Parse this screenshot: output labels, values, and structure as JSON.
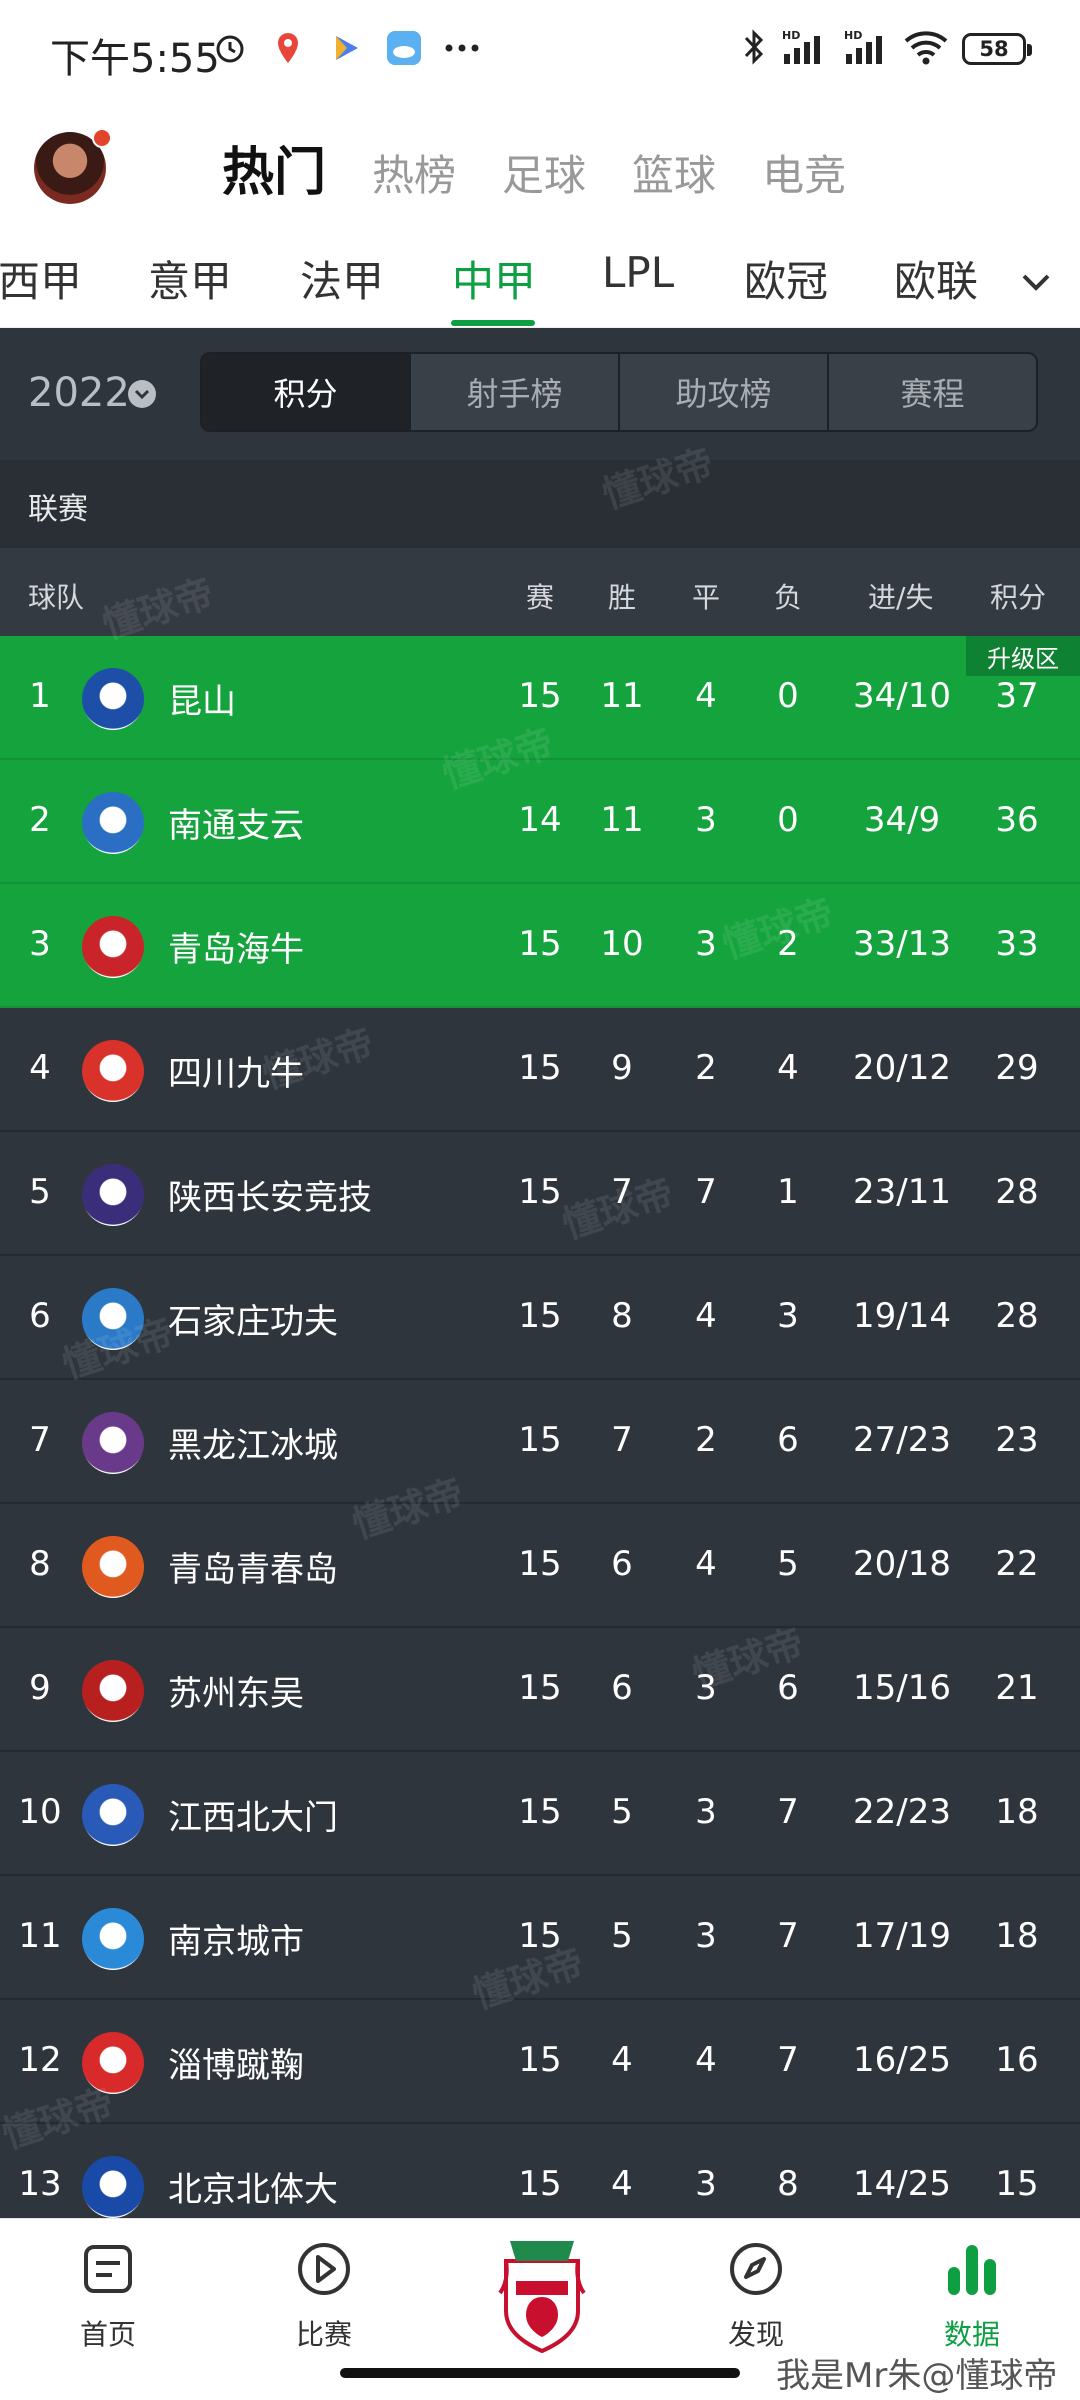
{
  "status_bar": {
    "time": "下午5:55",
    "battery": "58",
    "icons_left": [
      "alarm-icon",
      "location-icon",
      "video-app-icon",
      "weather-icon",
      "more-dots-icon"
    ],
    "icons_right": [
      "bluetooth-icon",
      "signal-hd-1-icon",
      "signal-hd-2-icon",
      "wifi-icon",
      "battery-icon"
    ]
  },
  "header": {
    "tabs": [
      {
        "label": "热门",
        "active": true
      },
      {
        "label": "热榜",
        "active": false
      },
      {
        "label": "足球",
        "active": false
      },
      {
        "label": "篮球",
        "active": false
      },
      {
        "label": "电竞",
        "active": false
      }
    ]
  },
  "league_tabs": [
    {
      "label": "西甲"
    },
    {
      "label": "意甲"
    },
    {
      "label": "法甲"
    },
    {
      "label": "中甲",
      "active": true
    },
    {
      "label": "LPL"
    },
    {
      "label": "欧冠"
    },
    {
      "label": "欧联"
    }
  ],
  "filter": {
    "year": "2022",
    "segments": [
      "积分",
      "射手榜",
      "助攻榜",
      "赛程"
    ],
    "active_segment": "积分"
  },
  "section_label": "联赛",
  "table": {
    "headers": {
      "team": "球队",
      "played": "赛",
      "won": "胜",
      "drawn": "平",
      "lost": "负",
      "goals": "进/失",
      "points": "积分"
    },
    "promotion_badge": "升级区",
    "rows": [
      {
        "rank": "1",
        "team": "昆山",
        "played": "15",
        "won": "11",
        "drawn": "4",
        "lost": "0",
        "goals": "34/10",
        "points": "37",
        "promo": true,
        "logo_color": "#1e4fa8"
      },
      {
        "rank": "2",
        "team": "南通支云",
        "played": "14",
        "won": "11",
        "drawn": "3",
        "lost": "0",
        "goals": "34/9",
        "points": "36",
        "promo": true,
        "logo_color": "#2a6fc4"
      },
      {
        "rank": "3",
        "team": "青岛海牛",
        "played": "15",
        "won": "10",
        "drawn": "3",
        "lost": "2",
        "goals": "33/13",
        "points": "33",
        "promo": true,
        "logo_color": "#c8242a"
      },
      {
        "rank": "4",
        "team": "四川九牛",
        "played": "15",
        "won": "9",
        "drawn": "2",
        "lost": "4",
        "goals": "20/12",
        "points": "29",
        "promo": false,
        "logo_color": "#d8322a"
      },
      {
        "rank": "5",
        "team": "陕西长安竞技",
        "played": "15",
        "won": "7",
        "drawn": "7",
        "lost": "1",
        "goals": "23/11",
        "points": "28",
        "promo": false,
        "logo_color": "#3a2e7a"
      },
      {
        "rank": "6",
        "team": "石家庄功夫",
        "played": "15",
        "won": "8",
        "drawn": "4",
        "lost": "3",
        "goals": "19/14",
        "points": "28",
        "promo": false,
        "logo_color": "#2a7ac8"
      },
      {
        "rank": "7",
        "team": "黑龙江冰城",
        "played": "15",
        "won": "7",
        "drawn": "2",
        "lost": "6",
        "goals": "27/23",
        "points": "23",
        "promo": false,
        "logo_color": "#6a3a8a"
      },
      {
        "rank": "8",
        "team": "青岛青春岛",
        "played": "15",
        "won": "6",
        "drawn": "4",
        "lost": "5",
        "goals": "20/18",
        "points": "22",
        "promo": false,
        "logo_color": "#e05a20"
      },
      {
        "rank": "9",
        "team": "苏州东吴",
        "played": "15",
        "won": "6",
        "drawn": "3",
        "lost": "6",
        "goals": "15/16",
        "points": "21",
        "promo": false,
        "logo_color": "#b82020"
      },
      {
        "rank": "10",
        "team": "江西北大门",
        "played": "15",
        "won": "5",
        "drawn": "3",
        "lost": "7",
        "goals": "22/23",
        "points": "18",
        "promo": false,
        "logo_color": "#2a5ab8"
      },
      {
        "rank": "11",
        "team": "南京城市",
        "played": "15",
        "won": "5",
        "drawn": "3",
        "lost": "7",
        "goals": "17/19",
        "points": "18",
        "promo": false,
        "logo_color": "#2a8ad8"
      },
      {
        "rank": "12",
        "team": "淄博蹴鞠",
        "played": "15",
        "won": "4",
        "drawn": "4",
        "lost": "7",
        "goals": "16/25",
        "points": "16",
        "promo": false,
        "logo_color": "#d82a2a"
      },
      {
        "rank": "13",
        "team": "北京北体大",
        "played": "15",
        "won": "4",
        "drawn": "3",
        "lost": "8",
        "goals": "14/25",
        "points": "15",
        "promo": false,
        "logo_color": "#1a4aa8"
      }
    ]
  },
  "watermark_text": "懂球帝",
  "bottom_nav": [
    {
      "label": "首页",
      "icon": "home-icon",
      "active": false
    },
    {
      "label": "比赛",
      "icon": "play-icon",
      "active": false
    },
    {
      "label": "",
      "icon": "liverpool-crest-icon",
      "active": false
    },
    {
      "label": "发现",
      "icon": "discover-icon",
      "active": false
    },
    {
      "label": "数据",
      "icon": "data-bars-icon",
      "active": true
    }
  ],
  "credit": "我是Mr朱@懂球帝",
  "colors": {
    "accent_green": "#0d9f41",
    "promo_row": "#15a33d",
    "dark_bg": "#2f353d"
  }
}
